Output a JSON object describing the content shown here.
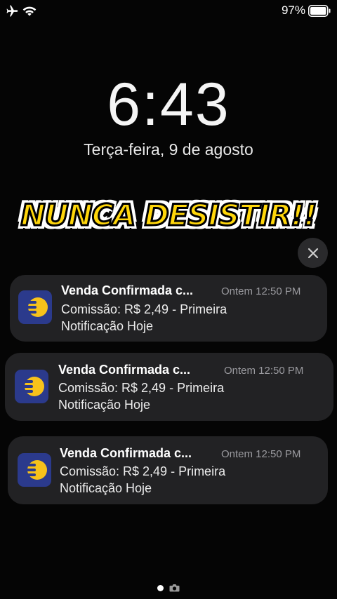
{
  "status_bar": {
    "battery_percent": "97%",
    "icons": [
      "airplane-icon",
      "wifi-icon",
      "battery-icon"
    ]
  },
  "lock_screen": {
    "time": "6:43",
    "date": "Terça-feira, 9 de agosto"
  },
  "overlay_caption": "NUNCA DESISTIR!!",
  "notifications": [
    {
      "title": "Venda Confirmada c...",
      "time": "Ontem 12:50 PM",
      "body": "Comissão: R$ 2,49 - Primeira Notificação Hoje",
      "icon": "app-icon"
    },
    {
      "title": "Venda Confirmada c...",
      "time": "Ontem 12:50 PM",
      "body": "Comissão: R$ 2,49 - Primeira Notificação Hoje",
      "icon": "app-icon"
    },
    {
      "title": "Venda Confirmada c...",
      "time": "Ontem 12:50 PM",
      "body": "Comissão: R$ 2,49 - Primeira Notificação Hoje",
      "icon": "app-icon"
    }
  ],
  "colors": {
    "background": "#050505",
    "notification_bg": "#222224",
    "app_icon_bg": "#2b3a8c",
    "app_icon_accent": "#f7c21b",
    "caption_fill": "#ffd60a"
  }
}
